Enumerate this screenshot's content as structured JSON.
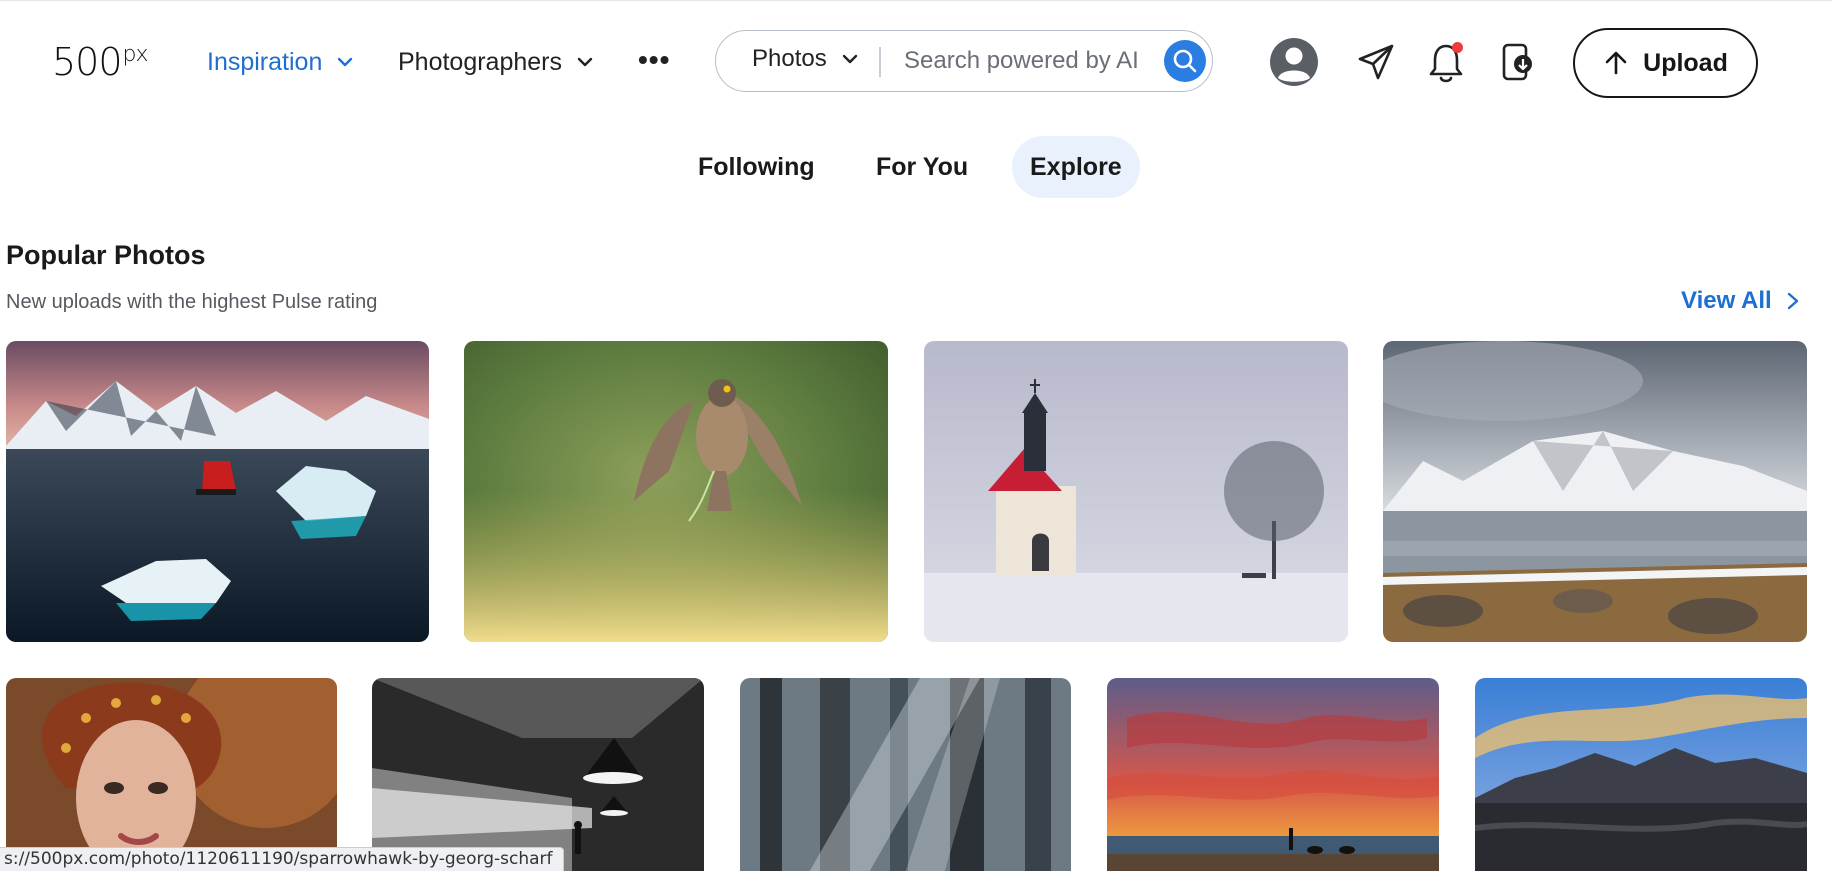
{
  "brand": {
    "logo_main": "500",
    "logo_sup": "px"
  },
  "nav": {
    "inspiration": "Inspiration",
    "photographers": "Photographers",
    "more": "•••"
  },
  "search": {
    "type_label": "Photos",
    "placeholder": "Search powered by AI",
    "value": ""
  },
  "header_icons": [
    "avatar-icon",
    "send-icon",
    "bell-icon",
    "downloads-icon"
  ],
  "upload": {
    "label": "Upload"
  },
  "tabs": [
    {
      "label": "Following",
      "active": false
    },
    {
      "label": "For You",
      "active": false
    },
    {
      "label": "Explore",
      "active": true
    }
  ],
  "section": {
    "title": "Popular Photos",
    "subtitle": "New uploads with the highest Pulse rating",
    "view_all": "View All"
  },
  "photos": [
    {
      "subject": "iceberg-bay-with-red-ship"
    },
    {
      "subject": "sparrowhawk-in-flight"
    },
    {
      "subject": "chapel-in-snow-with-tree"
    },
    {
      "subject": "snowy-mountain-lake"
    },
    {
      "subject": "woman-with-ornate-headdress"
    },
    {
      "subject": "monochrome-subway-station"
    },
    {
      "subject": "misty-forest-sunrays"
    },
    {
      "subject": "sunset-beach"
    },
    {
      "subject": "mountain-black-sand-dunes"
    }
  ],
  "status_url": "s://500px.com/photo/1120611190/sparrowhawk-by-georg-scharf",
  "colors": {
    "accent": "#1f6fd1",
    "search_button": "#2a7de1",
    "active_tab_bg": "#e8f1fc",
    "notification": "#ee3b3b"
  }
}
